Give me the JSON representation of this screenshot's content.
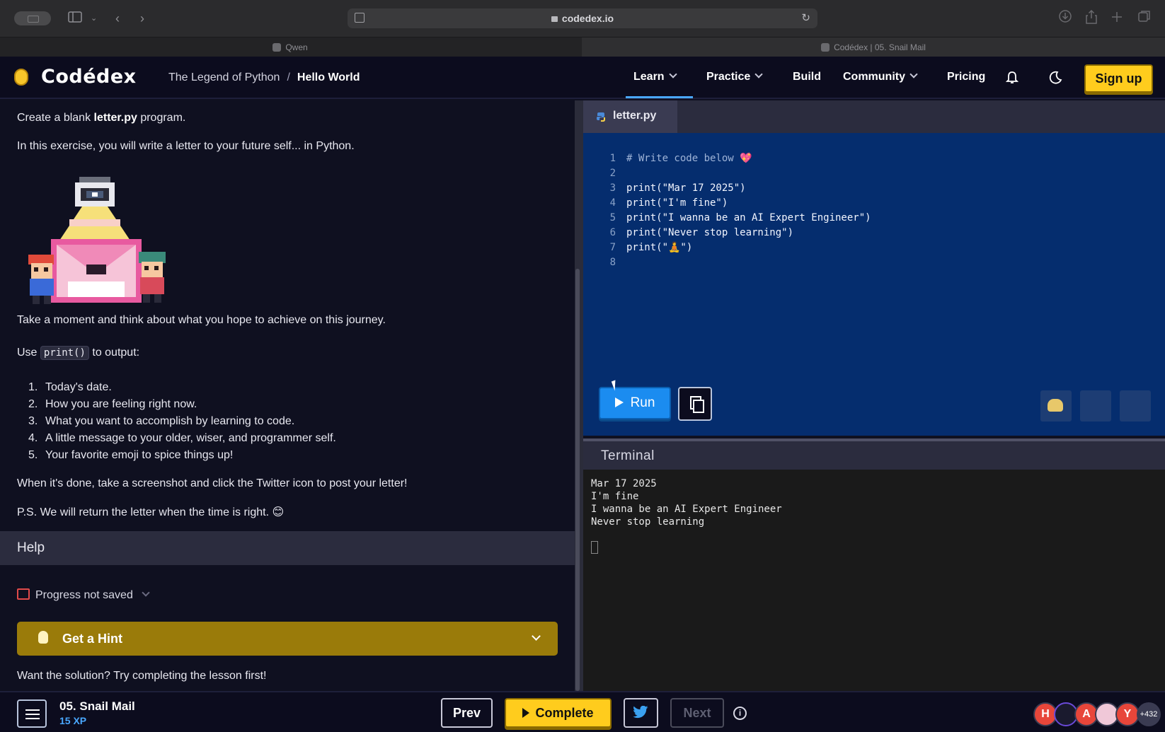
{
  "browser": {
    "url": "codedex.io",
    "tabs": [
      {
        "label": "Qwen"
      },
      {
        "label": "Codédex | 05. Snail Mail"
      }
    ]
  },
  "header": {
    "logo": "Codédex",
    "breadcrumb": {
      "course": "The Legend of Python",
      "separator": "/",
      "lesson": "Hello World"
    },
    "nav": [
      {
        "label": "Learn"
      },
      {
        "label": "Practice"
      },
      {
        "label": "Build"
      },
      {
        "label": "Community"
      },
      {
        "label": "Pricing"
      }
    ],
    "signup_label": "Sign up",
    "accent_color": "#ffcc1d"
  },
  "lesson": {
    "intro_prefix": "Create a blank ",
    "intro_file": "letter.py",
    "intro_suffix": " program.",
    "exercise_text": "In this exercise, you will write a letter to your future self... in Python.",
    "reflect_text": "Take a moment and think about what you hope to achieve on this journey.",
    "use_prefix": "Use ",
    "use_code": "print()",
    "use_suffix": " to output:",
    "steps": [
      {
        "num": "1.",
        "text": "Today's date."
      },
      {
        "num": "2.",
        "text": "How you are feeling right now."
      },
      {
        "num": "3.",
        "text": "What you want to accomplish by learning to code."
      },
      {
        "num": "4.",
        "text": "A little message to your older, wiser, and programmer self."
      },
      {
        "num": "5.",
        "text": "Your favorite emoji to spice things up!"
      }
    ],
    "twitter_text": "When it's done, take a screenshot and click the Twitter icon to post your letter!",
    "ps_text": "P.S. We will return the letter when the time is right. 😊"
  },
  "help": {
    "title": "Help",
    "progress": "Progress not saved",
    "hint_label": "Get a Hint",
    "solution_text": "Want the solution? Try completing the lesson first!"
  },
  "editor": {
    "filename": "letter.py",
    "lines": [
      {
        "n": "1",
        "code": "# Write code below 💖"
      },
      {
        "n": "2",
        "code": ""
      },
      {
        "n": "3",
        "code": "print(\"Mar 17 2025\")"
      },
      {
        "n": "4",
        "code": "print(\"I'm fine\")"
      },
      {
        "n": "5",
        "code": "print(\"I wanna be an AI Expert Engineer\")"
      },
      {
        "n": "6",
        "code": "print(\"Never stop learning\")"
      },
      {
        "n": "7",
        "code": "print(\"🧘\")"
      },
      {
        "n": "8",
        "code": ""
      }
    ],
    "run_label": "Run"
  },
  "terminal": {
    "title": "Terminal",
    "output": [
      "Mar 17 2025",
      "I'm fine",
      "I wanna be an AI Expert Engineer",
      "Never stop learning"
    ]
  },
  "footer": {
    "lesson_title": "05. Snail Mail",
    "xp": "15 XP",
    "prev_label": "Prev",
    "complete_label": "Complete",
    "next_label": "Next",
    "info_symbol": "i",
    "avatars": [
      {
        "letter": "H",
        "color": "#e8463a"
      },
      {
        "letter": "",
        "color": "#1a1a2e"
      },
      {
        "letter": "A",
        "color": "#e8463a"
      },
      {
        "letter": "",
        "color": "#f0c8d8"
      },
      {
        "letter": "Y",
        "color": "#e8463a"
      }
    ],
    "avatar_more": "+432"
  }
}
